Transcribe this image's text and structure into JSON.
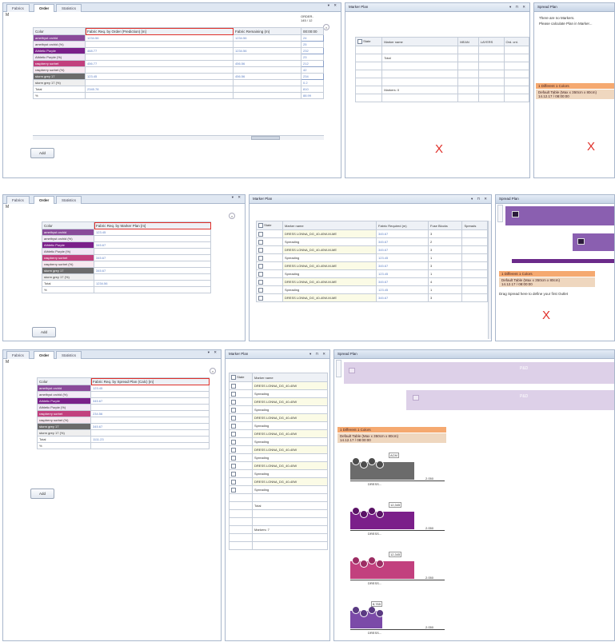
{
  "tabs": [
    "Fabrics",
    "Order",
    "Statistics"
  ],
  "corner_label": "M",
  "add_button": "Add",
  "colors": {
    "accent_red": "#e0302a",
    "purple": "#7b1f8a",
    "raspberry": "#c2407e",
    "gray_dark": "#6b6b6b",
    "orange": "#f5a970",
    "tan": "#efd7bf"
  },
  "bands": [
    {
      "fabric_header": "Fabric Req. by Order (Prediction) [m]",
      "col_remaining": "Fabric Remaining (m)",
      "col_order": "00:00:00",
      "order_stamp": "ORDER-145 / 12",
      "colors": [
        {
          "name": "amethyst orchid",
          "val": "1234.56",
          "rem": "1234.56",
          "ord": "24"
        },
        {
          "name": "amethyst orchid (%)",
          "val": "",
          "rem": "",
          "ord": "25"
        },
        {
          "name": "Athletic Purple",
          "val": "468.77",
          "rem": "1234.56",
          "ord": "232"
        },
        {
          "name": "Athletic Purple (%)",
          "val": "",
          "rem": "",
          "ord": "23"
        },
        {
          "name": "raspberry sorbet",
          "val": "456.77",
          "rem": "456.56",
          "ord": "212"
        },
        {
          "name": "raspberry sorbet (%)",
          "val": "",
          "rem": "",
          "ord": "42"
        },
        {
          "name": "storm grey 17",
          "val": "123.45",
          "rem": "456.56",
          "ord": "234"
        },
        {
          "name": "storm grey 17 (%)",
          "val": "",
          "rem": "",
          "ord": "0.2"
        },
        {
          "name": "Total",
          "val": "2345.78",
          "rem": "",
          "ord": "810"
        },
        {
          "name": "%",
          "val": "",
          "rem": "",
          "ord": "88.99"
        }
      ],
      "marker_title": "Marker Plan",
      "marker_cols": [
        "State",
        "Marker name",
        "MEAN",
        "LAYERS",
        "Ord. cnt."
      ],
      "marker_rows": [
        "",
        "Total",
        "",
        "",
        "",
        "Markers: 0",
        ""
      ],
      "spread_title": "Spread Plan",
      "spread_text": [
        "There are no Markers.",
        "Please calculate Plan in Marker..."
      ],
      "spread_orange": "1 Different 1 Colors",
      "spread_tan": [
        "Default Table (Max x 350cm x 80cm)",
        "14.12.17 / 08:00:00"
      ]
    },
    {
      "fabric_header": "Fabric Req. by Marker Plan [m]",
      "colors": [
        {
          "name": "amethyst orchid",
          "val": "123.45"
        },
        {
          "name": "amethyst orchid (%)",
          "val": ""
        },
        {
          "name": "Athletic Purple",
          "val": "345.67"
        },
        {
          "name": "Athletic Purple (%)",
          "val": ""
        },
        {
          "name": "raspberry sorbet",
          "val": "345.67"
        },
        {
          "name": "raspberry sorbet (%)",
          "val": ""
        },
        {
          "name": "storm grey 17",
          "val": "345.67"
        },
        {
          "name": "storm grey 17 (%)",
          "val": ""
        },
        {
          "name": "Total",
          "val": "1234.56"
        },
        {
          "name": "%",
          "val": ""
        }
      ],
      "marker_title": "Marker Plan",
      "marker_cols": [
        "State",
        "Marker name",
        "Fabric Required (m)",
        "Fuse Blocks",
        "Spreads"
      ],
      "marker_rows": [
        {
          "name": "DRESS LONNA_DG_40-40W-M-ME",
          "req": "345.67",
          "blk": "3"
        },
        {
          "name": "Spreading",
          "req": "345.67",
          "blk": "2"
        },
        {
          "name": "DRESS LONNA_DG_40-40W-M-ME",
          "req": "345.67",
          "blk": "3"
        },
        {
          "name": "Spreading",
          "req": "123.45",
          "blk": "1"
        },
        {
          "name": "DRESS LONNA_DG_40-40W-M-ME",
          "req": "345.67",
          "blk": "3"
        },
        {
          "name": "Spreading",
          "req": "123.45",
          "blk": "1"
        },
        {
          "name": "DRESS LONNA_DG_40-40W-M-ME",
          "req": "345.67",
          "blk": "4"
        },
        {
          "name": "Spreading",
          "req": "123.45",
          "blk": "1"
        },
        {
          "name": "DRESS LONNA_DG_40-40W-M-ME",
          "req": "345.67",
          "blk": "3"
        }
      ],
      "spread_title": "Spread Plan",
      "spread_orange": "1 Different 1 Colors",
      "spread_tan": [
        "Default Table (Max x 350cm x 80cm)",
        "14.12.17 / 08:00:00"
      ],
      "spread_drag": "Drag Spread here to define your first Outlet"
    },
    {
      "fabric_header": "Fabric Req. by Spread Plan (Calc) [m]",
      "colors": [
        {
          "name": "amethyst orchid",
          "val": "123.45"
        },
        {
          "name": "amethyst orchid (%)",
          "val": ""
        },
        {
          "name": "Athletic Purple",
          "val": "345.67"
        },
        {
          "name": "Athletic Purple (%)",
          "val": ""
        },
        {
          "name": "raspberry sorbet",
          "val": "234.56"
        },
        {
          "name": "raspberry sorbet (%)",
          "val": ""
        },
        {
          "name": "storm grey 17",
          "val": "345.67"
        },
        {
          "name": "storm grey 17 (%)",
          "val": ""
        },
        {
          "name": "Total",
          "val": "1111.23"
        },
        {
          "name": "%",
          "val": ""
        }
      ],
      "marker_title": "Marker Plan",
      "marker_cols": [
        "State",
        "Marker name"
      ],
      "marker_rows": [
        "DRESS LONNA_DG_40-40W",
        "Spreading",
        "DRESS LONNA_DG_40-40W",
        "Spreading",
        "DRESS LONNA_DG_40-40W",
        "Spreading",
        "DRESS LONNA_DG_40-40W",
        "Spreading",
        "DRESS LONNA_DG_40-40W",
        "Spreading",
        "DRESS LONNA_DG_40-40W",
        "Spreading",
        "DRESS LONNA_DG_40-40W",
        "Spreading"
      ],
      "marker_footer": [
        "Total",
        "Markers: 7"
      ],
      "spread_title": "Spread Plan",
      "spread_bars": [
        {
          "label": "P&D"
        },
        {
          "label": "P&D"
        }
      ],
      "spread_orange": "1 Different 1 Colors",
      "spread_tan": [
        "Default Table (Max x 350cm x 80cm)",
        "14.12.17 / 08:00:00"
      ],
      "thumbs": [
        {
          "tag": "ACM",
          "label": "DRESS...",
          "end": "2.050"
        },
        {
          "tag": "12,345",
          "label": "DRESS...",
          "end": "2.050"
        },
        {
          "tag": "12,345",
          "label": "DRESS...",
          "end": "2.050"
        },
        {
          "tag": "8,765",
          "label": "DRESS...",
          "end": "2.050"
        }
      ]
    }
  ]
}
